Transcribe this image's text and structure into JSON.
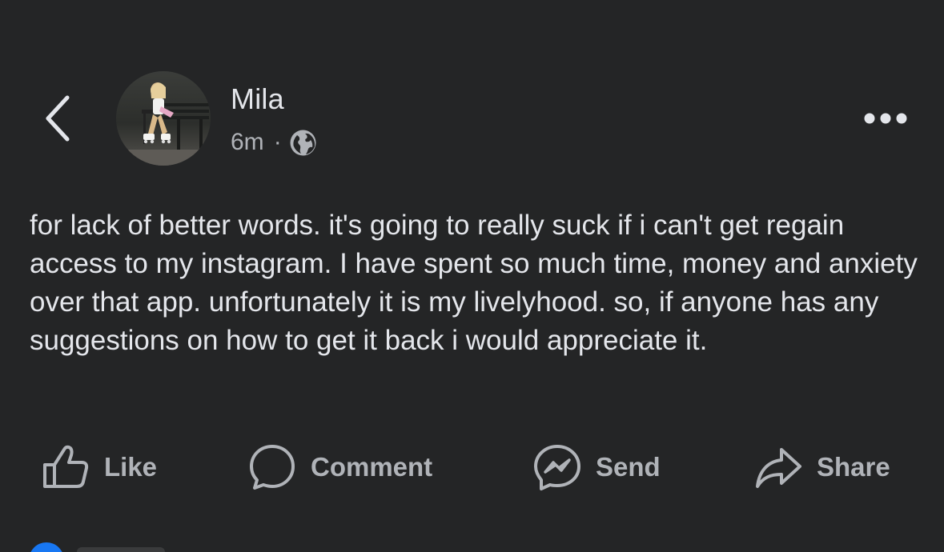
{
  "post": {
    "author": "Mila",
    "time": "6m",
    "separator": "·",
    "privacy_icon": "globe-icon",
    "text": "for lack of better words. it's going to really suck if i can't get regain access to my instagram. I have spent so much time, money and anxiety over that app. unfortunately it is my livelyhood. so, if anyone has any suggestions on how to get it back i would appreciate it."
  },
  "actions": {
    "like": "Like",
    "comment": "Comment",
    "send": "Send",
    "share": "Share"
  },
  "colors": {
    "background": "#242526",
    "primary_text": "#e4e6eb",
    "secondary_text": "#b0b3b8",
    "accent": "#1877f2"
  }
}
